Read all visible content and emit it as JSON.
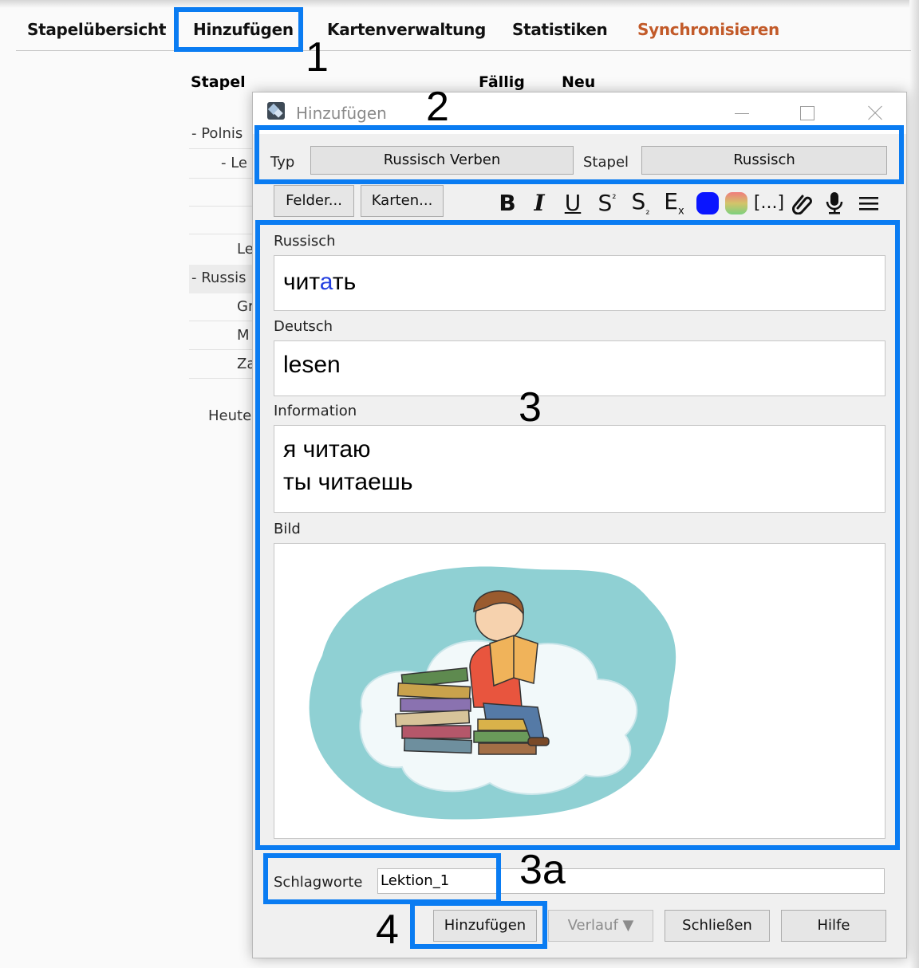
{
  "toolbar": {
    "decks": "Stapelübersicht",
    "add": "Hinzufügen",
    "browse": "Kartenverwaltung",
    "stats": "Statistiken",
    "sync": "Synchronisieren"
  },
  "deck_list": {
    "headers": {
      "deck": "Stapel",
      "due": "Fällig",
      "new": "Neu"
    },
    "rows": [
      "- Polnis",
      "- Le",
      "Le",
      "- Russis",
      "Gr",
      "M",
      "Za"
    ],
    "footer": "Heute"
  },
  "dialog": {
    "title": "Hinzufügen",
    "type_label": "Typ",
    "type_value": "Russisch Verben",
    "deck_label": "Stapel",
    "deck_value": "Russisch",
    "fields_button": "Felder...",
    "cards_button": "Karten...",
    "format_icons": [
      "bold-icon",
      "italic-icon",
      "underline-icon",
      "superscript-icon",
      "subscript-icon",
      "clear-format-icon",
      "text-color-icon",
      "highlight-color-icon",
      "cloze-icon",
      "attach-icon",
      "record-audio-icon",
      "more-menu-icon"
    ],
    "format_labels": {
      "bold": "B",
      "italic": "I",
      "underline": "U",
      "cloze": "[...]"
    },
    "text_color": "#0a15ff",
    "fields": [
      {
        "label": "Russisch",
        "value_pre": "чит",
        "value_accent": "а",
        "value_post": "ть"
      },
      {
        "label": "Deutsch",
        "value": "lesen"
      },
      {
        "label": "Information",
        "line1": "я читаю",
        "line2": "ты читаешь"
      },
      {
        "label": "Bild",
        "image": "boy-reading-on-cloud-illustration"
      }
    ],
    "tags_label": "Schlagworte",
    "tags_value": "Lektion_1",
    "add_button": "Hinzufügen",
    "history_button": "Verlauf ▼",
    "close_button": "Schließen",
    "help_button": "Hilfe"
  },
  "annotations": [
    "1",
    "2",
    "3",
    "3a",
    "4"
  ],
  "colors": {
    "highlight": "#0a7cf2",
    "sync": "#c25a29",
    "accent_letter": "#2440e0"
  }
}
